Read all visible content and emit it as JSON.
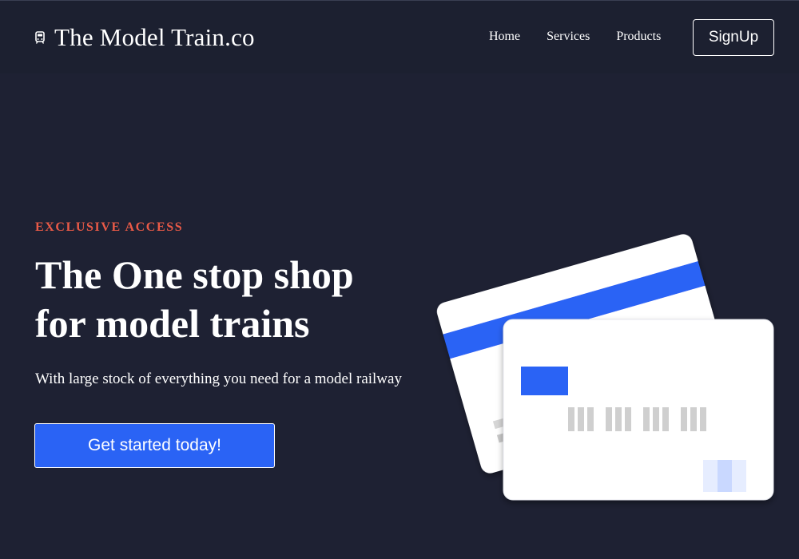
{
  "header": {
    "brand_icon": "train-icon",
    "brand_name": "The Model Train.co",
    "nav": [
      {
        "label": "Home"
      },
      {
        "label": "Services"
      },
      {
        "label": "Products"
      }
    ],
    "signup_label": "SignUp"
  },
  "hero": {
    "eyebrow": "EXCLUSIVE ACCESS",
    "headline": "The One stop shop for model trains",
    "subtext": "With large stock of everything you need for a model railway",
    "cta_label": "Get started today!",
    "illustration_icon": "credit-cards-icon"
  },
  "colors": {
    "background": "#1e2133",
    "accent": "#2a63f5",
    "eyebrow": "#ea5a47",
    "text": "#ffffff"
  }
}
